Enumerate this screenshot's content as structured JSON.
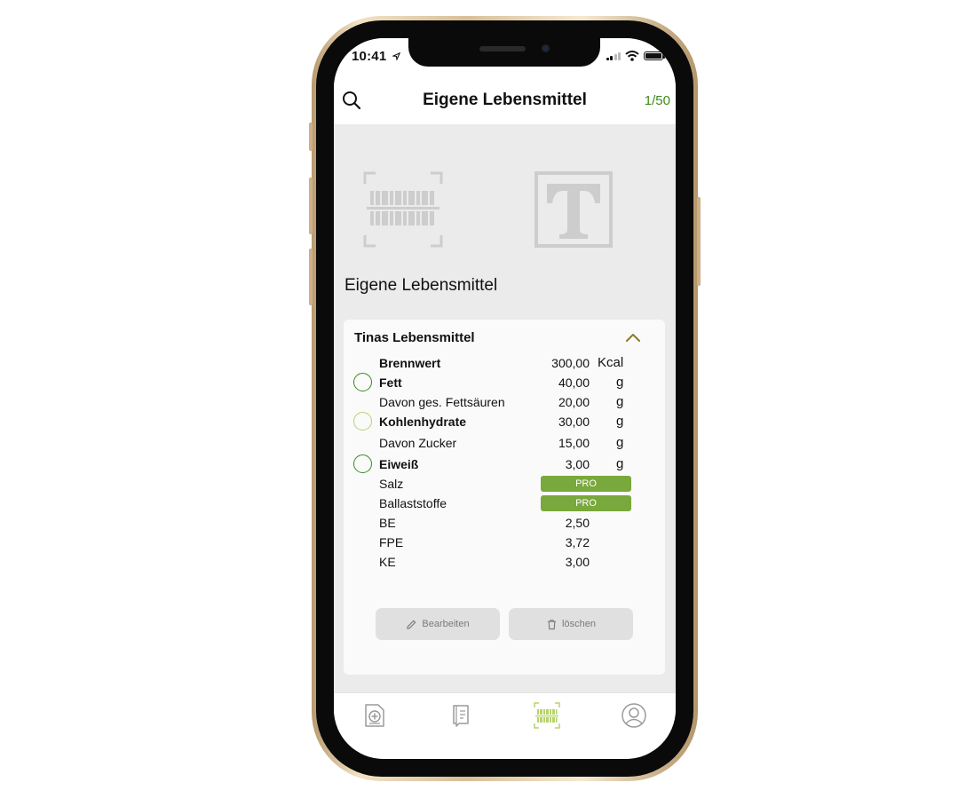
{
  "status_bar": {
    "time": "10:41"
  },
  "nav": {
    "title": "Eigene Lebensmittel",
    "counter": "1/50"
  },
  "section_title": "Eigene Lebensmittel",
  "card": {
    "title": "Tinas Lebensmittel",
    "rows": [
      {
        "label": "Brennwert",
        "value": "300,00",
        "unit": "Kcal"
      },
      {
        "label": "Fett",
        "value": "40,00",
        "unit": "g"
      },
      {
        "label": "Davon ges. Fettsäuren",
        "value": "20,00",
        "unit": "g"
      },
      {
        "label": "Kohlenhydrate",
        "value": "30,00",
        "unit": "g"
      },
      {
        "label": "Davon Zucker",
        "value": "15,00",
        "unit": "g"
      },
      {
        "label": "Eiweiß",
        "value": "3,00",
        "unit": "g"
      },
      {
        "label": "Salz",
        "badge": "PRO"
      },
      {
        "label": "Ballaststoffe",
        "badge": "PRO"
      },
      {
        "label": "BE",
        "value": "2,50"
      },
      {
        "label": "FPE",
        "value": "3,72"
      },
      {
        "label": "KE",
        "value": "3,00"
      }
    ],
    "edit_label": "Bearbeiten",
    "delete_label": "löschen"
  },
  "colors": {
    "accent_green": "#3b8a1c",
    "lime": "#b6d36b",
    "pro_badge": "#79a83c",
    "chevron": "#8a7a2a"
  },
  "icons": {
    "search": "search-icon",
    "barcode_scan": "barcode-scan-icon",
    "text_input": "text-input-icon",
    "chevron_up": "chevron-up-icon",
    "edit": "pencil-icon",
    "delete": "trash-icon",
    "tabs": [
      "add-document-icon",
      "diary-icon",
      "barcode-icon",
      "profile-icon"
    ]
  }
}
